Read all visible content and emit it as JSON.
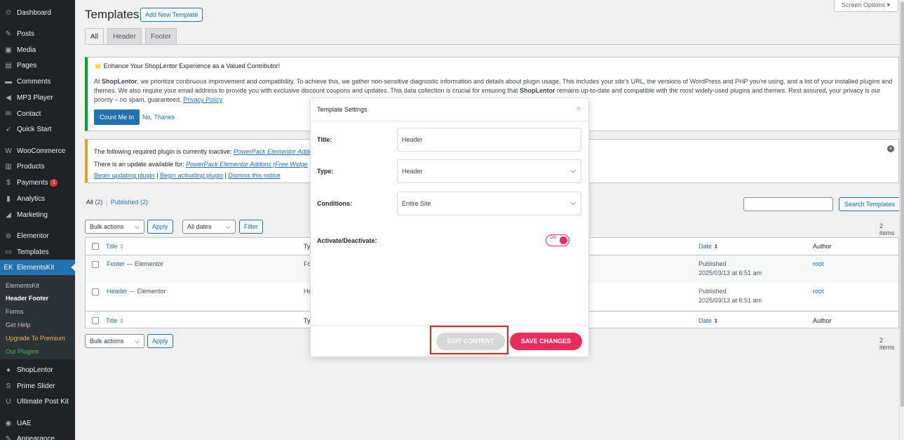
{
  "sidebar": {
    "items": [
      {
        "label": "Dashboard",
        "icon": "dashboard-icon",
        "glyph": "⏲"
      },
      {
        "label": "Posts",
        "icon": "pin-icon",
        "glyph": "✎"
      },
      {
        "label": "Media",
        "icon": "media-icon",
        "glyph": "▣"
      },
      {
        "label": "Pages",
        "icon": "pages-icon",
        "glyph": "▤"
      },
      {
        "label": "Comments",
        "icon": "comment-icon",
        "glyph": "▬"
      },
      {
        "label": "MP3 Player",
        "icon": "speaker-icon",
        "glyph": "◀"
      },
      {
        "label": "Contact",
        "icon": "mail-icon",
        "glyph": "✉"
      },
      {
        "label": "Quick Start",
        "icon": "rocket-icon",
        "glyph": "➶"
      },
      {
        "label": "WooCommerce",
        "icon": "woo-icon",
        "glyph": "W"
      },
      {
        "label": "Products",
        "icon": "archive-icon",
        "glyph": "▥"
      },
      {
        "label": "Payments",
        "icon": "dollar-icon",
        "glyph": "$",
        "badge": "1"
      },
      {
        "label": "Analytics",
        "icon": "bar-chart-icon",
        "glyph": "▮"
      },
      {
        "label": "Marketing",
        "icon": "megaphone-icon",
        "glyph": "◢"
      },
      {
        "label": "Elementor",
        "icon": "elementor-icon",
        "glyph": "⊜"
      },
      {
        "label": "Templates",
        "icon": "folder-icon",
        "glyph": "▭"
      },
      {
        "label": "ElementsKit",
        "icon": "elementskit-icon",
        "glyph": "EK"
      },
      {
        "label": "ShopLentor",
        "icon": "shoplentor-icon",
        "glyph": "●"
      },
      {
        "label": "Prime Slider",
        "icon": "prime-slider-icon",
        "glyph": "S"
      },
      {
        "label": "Ultimate Post Kit",
        "icon": "upk-icon",
        "glyph": "U"
      },
      {
        "label": "UAE",
        "icon": "uae-icon",
        "glyph": "◉"
      },
      {
        "label": "Appearance",
        "icon": "brush-icon",
        "glyph": "✎"
      }
    ],
    "submenu": [
      "ElementsKit",
      "Header Footer",
      "Forms",
      "Get Help",
      "Upgrade To Premium",
      "Our Plugins"
    ]
  },
  "header": {
    "title": "Templates",
    "add_new": "Add New Template",
    "screen_options": "Screen Options ▾"
  },
  "tabs": [
    "All",
    "Header",
    "Footer"
  ],
  "notice1": {
    "title": "⭐ Enhance Your ShopLentor Experience as a Valued Contributor!",
    "text_a": "At ",
    "brand": "ShopLentor",
    "text_b": ", we prioritize continuous improvement and compatibility. To achieve this, we gather non-sensitive diagnostic information and details about plugin usage. This includes your site's URL, the versions of WordPress and PHP you're using, and a list of your installed plugins and themes. We also require your email address to provide you with exclusive discount coupons and updates. This data collection is crucial for ensuring that ",
    "brand2": "ShopLentor",
    "text_c": " remains up-to-date and compatible with the most widely-used plugins and themes. Rest assured, your privacy is our priority – no spam, guaranteed. ",
    "privacy": "Privacy Policy",
    "count_me_in": "Count Me In",
    "no_thanks": "No, Thanks"
  },
  "notice2": {
    "line1_text": "The following required plugin is currently inactive: ",
    "line1_link": "PowerPack Elementor Addo",
    "line2_text": "There is an update available for: ",
    "line2_link": "PowerPack Elementor Addons (Free Widge",
    "link_update": "Begin updating plugin",
    "sep": " | ",
    "link_activate": "Begin activating plugin",
    "link_dismiss": "Dismiss this notice"
  },
  "filters": {
    "all": "All",
    "all_count": "(2)",
    "sep": "|",
    "published": "Published",
    "published_count": "(2)",
    "search_button": "Search Templates",
    "bulk_actions": "Bulk actions",
    "apply": "Apply",
    "all_dates": "All dates",
    "filter": "Filter",
    "items_count": "2 items"
  },
  "table": {
    "col_title": "Title",
    "col_type": "Ty",
    "col_date": "Date",
    "col_author": "Author",
    "rows": [
      {
        "title": "Footer",
        "suffix": " — Elementor",
        "type": "Fo",
        "status": "Published",
        "date": "2025/03/13 at 6:51 am",
        "author": "root"
      },
      {
        "title": "Header",
        "suffix": " — Elementor",
        "type": "He",
        "status": "Published",
        "date": "2025/03/13 at 6:51 am",
        "author": "root"
      }
    ]
  },
  "modal": {
    "title": "Template Settings",
    "close": "×",
    "title_label": "Title:",
    "title_value": "Header",
    "type_label": "Type:",
    "type_value": "Header",
    "conditions_label": "Conditions:",
    "conditions_value": "Entire Site",
    "activate_label": "Activate/Deactivate:",
    "toggle_text": "ON",
    "edit_content": "EDIT CONTENT",
    "save_changes": "SAVE CHANGES"
  },
  "colors": {
    "accent": "#2271b1",
    "sidebar_bg": "#1d2327",
    "brand_pink": "#ea2b5d",
    "highlight_red": "#e02424"
  }
}
